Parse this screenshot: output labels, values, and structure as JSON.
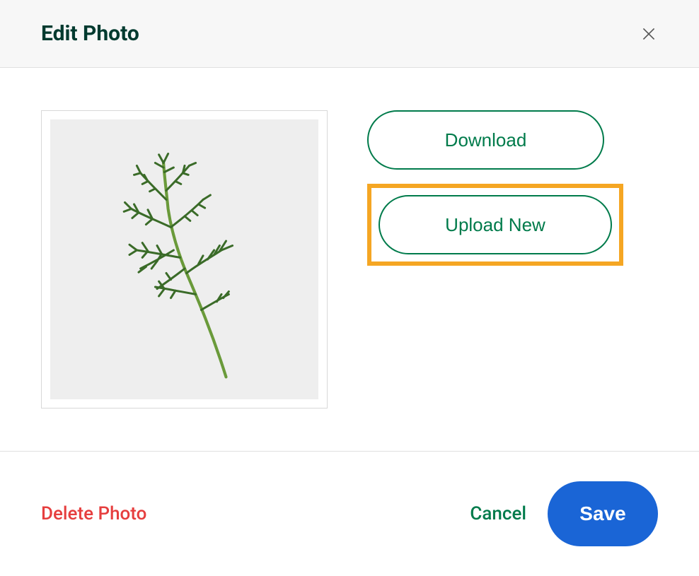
{
  "header": {
    "title": "Edit Photo"
  },
  "actions": {
    "download_label": "Download",
    "upload_label": "Upload New"
  },
  "footer": {
    "delete_label": "Delete Photo",
    "cancel_label": "Cancel",
    "save_label": "Save"
  },
  "photo": {
    "description": "plant-sprig"
  }
}
